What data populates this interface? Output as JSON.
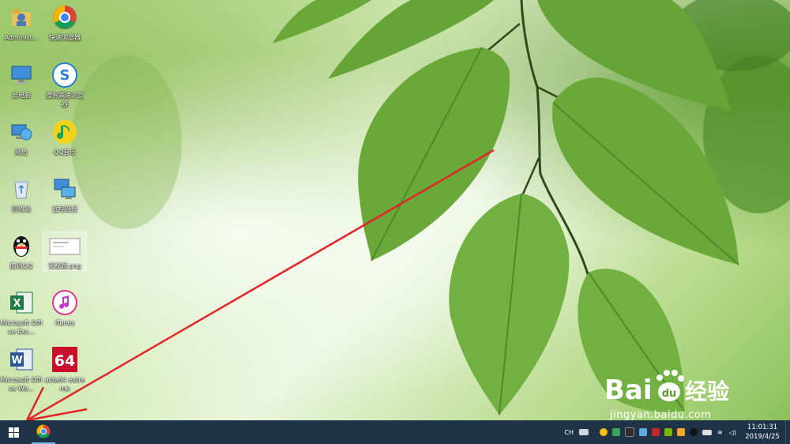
{
  "desktop": {
    "icons": [
      {
        "label": "Administ..."
      },
      {
        "label": "快速浏览器"
      },
      {
        "label": "此电脑"
      },
      {
        "label": "搜狗高速浏览器"
      },
      {
        "label": "网络"
      },
      {
        "label": "QQ音乐"
      },
      {
        "label": "回收站"
      },
      {
        "label": "远程连接"
      },
      {
        "label": "腾讯QQ"
      },
      {
        "label": "无标题.png"
      },
      {
        "label": "Microsoft Office Exc..."
      },
      {
        "label": "iTunes"
      },
      {
        "label": "Microsoft Office Wo..."
      },
      {
        "label": "aida64 extreme"
      }
    ]
  },
  "taskbar": {
    "ime": "CH",
    "time": "11:01:31",
    "date": "2019/4/25"
  },
  "watermark": {
    "brand": "Bai",
    "brand_du": "du",
    "brand_cn": "经验",
    "url": "jingyan.baidu.com"
  },
  "colors": {
    "taskbar": "#1e3347",
    "arrow": "#e0262a",
    "leaf": "#6aa83a"
  }
}
